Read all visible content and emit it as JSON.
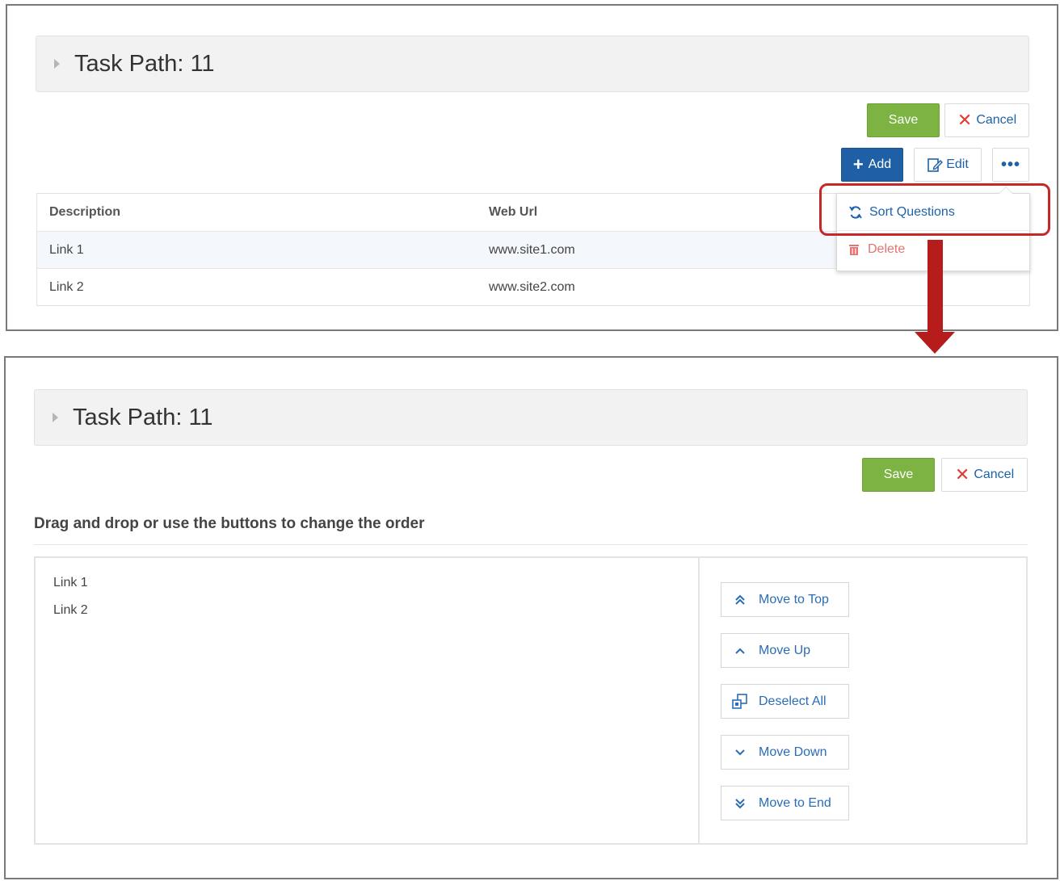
{
  "top_panel": {
    "title": "Task Path: 11",
    "save_label": "Save",
    "cancel_label": "Cancel",
    "add_label": "Add",
    "edit_label": "Edit",
    "table": {
      "headers": [
        "Description",
        "Web Url"
      ],
      "rows": [
        [
          "Link 1",
          "www.site1.com"
        ],
        [
          "Link 2",
          "www.site2.com"
        ]
      ]
    },
    "menu": {
      "sort_label": "Sort Questions",
      "delete_label": "Delete"
    }
  },
  "bottom_panel": {
    "title": "Task Path: 11",
    "save_label": "Save",
    "cancel_label": "Cancel",
    "instruction": "Drag and drop or use the buttons to change the order",
    "items": [
      "Link 1",
      "Link 2"
    ],
    "actions": {
      "move_to_top": "Move to Top",
      "move_up": "Move Up",
      "deselect_all": "Deselect All",
      "move_down": "Move Down",
      "move_to_end": "Move to End"
    }
  },
  "colors": {
    "save_green": "#7cb342",
    "primary_blue": "#1f5fa6",
    "link_blue": "#1d62a8",
    "cancel_red": "#e53935",
    "highlight_red": "#c62828"
  }
}
